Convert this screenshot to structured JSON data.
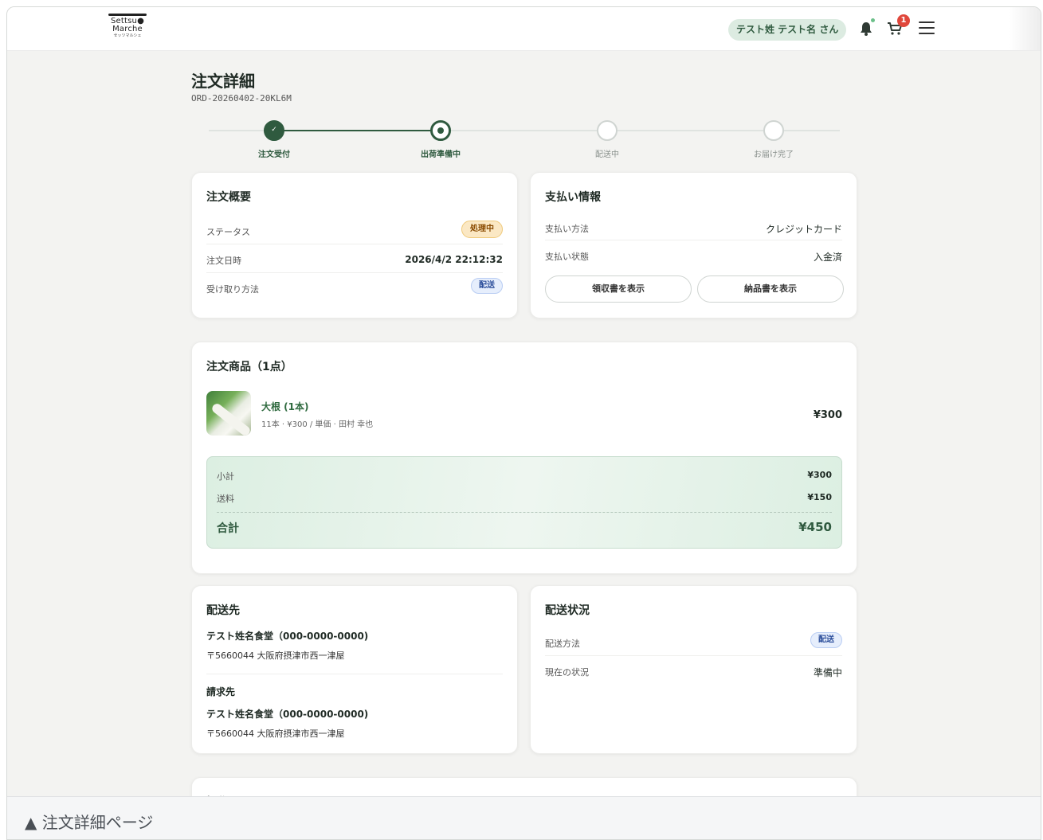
{
  "header": {
    "logo_line1": "Settsu●",
    "logo_line2": "Marche",
    "logo_sub": "セッツマルシェ",
    "user_label": "テスト姓 テスト名 さん",
    "cart_count": "1"
  },
  "page": {
    "title": "注文詳細",
    "order_id": "ORD-20260402-20KL6M"
  },
  "stepper": {
    "steps": [
      {
        "label": "注文受付",
        "state": "done"
      },
      {
        "label": "出荷準備中",
        "state": "current"
      },
      {
        "label": "配送中",
        "state": "pending"
      },
      {
        "label": "お届け完了",
        "state": "pending"
      }
    ]
  },
  "summary": {
    "title": "注文概要",
    "status_label": "ステータス",
    "status_value": "処理中",
    "date_label": "注文日時",
    "date_value": "2026/4/2 22:12:32",
    "pickup_label": "受け取り方法",
    "pickup_value": "配送"
  },
  "payment": {
    "title": "支払い情報",
    "method_label": "支払い方法",
    "method_value": "クレジットカード",
    "state_label": "支払い状態",
    "state_value": "入金済",
    "receipt_button": "領収書を表示",
    "invoice_button": "納品書を表示"
  },
  "items": {
    "title": "注文商品（1点）",
    "list": [
      {
        "name": "大根 (1本)",
        "meta": "11本 · ¥300 / 単価 · 田村 幸也",
        "price": "¥300"
      }
    ],
    "subtotal_label": "小計",
    "subtotal_value": "¥300",
    "shipping_label": "送料",
    "shipping_value": "¥150",
    "total_label": "合計",
    "total_value": "¥450"
  },
  "shipping_address": {
    "title": "配送先",
    "name": "テスト姓名食堂（000-0000-0000)",
    "address": "〒5660044 大阪府摂津市西一津屋",
    "billing_title": "請求先",
    "billing_name": "テスト姓名食堂（000-0000-0000)",
    "billing_address": "〒5660044 大阪府摂津市西一津屋"
  },
  "delivery": {
    "title": "配送状況",
    "method_label": "配送方法",
    "method_value": "配送",
    "status_label": "現在の状況",
    "status_value": "準備中"
  },
  "operations": {
    "title": "操作"
  },
  "caption": "▲ 注文詳細ページ",
  "colors": {
    "primary": "#2f5a3f",
    "accent_green": "#2f6a3f",
    "badge_amber_bg": "#fbe8c4",
    "badge_blue_bg": "#e6eefc",
    "cart_badge": "#e0473b"
  }
}
